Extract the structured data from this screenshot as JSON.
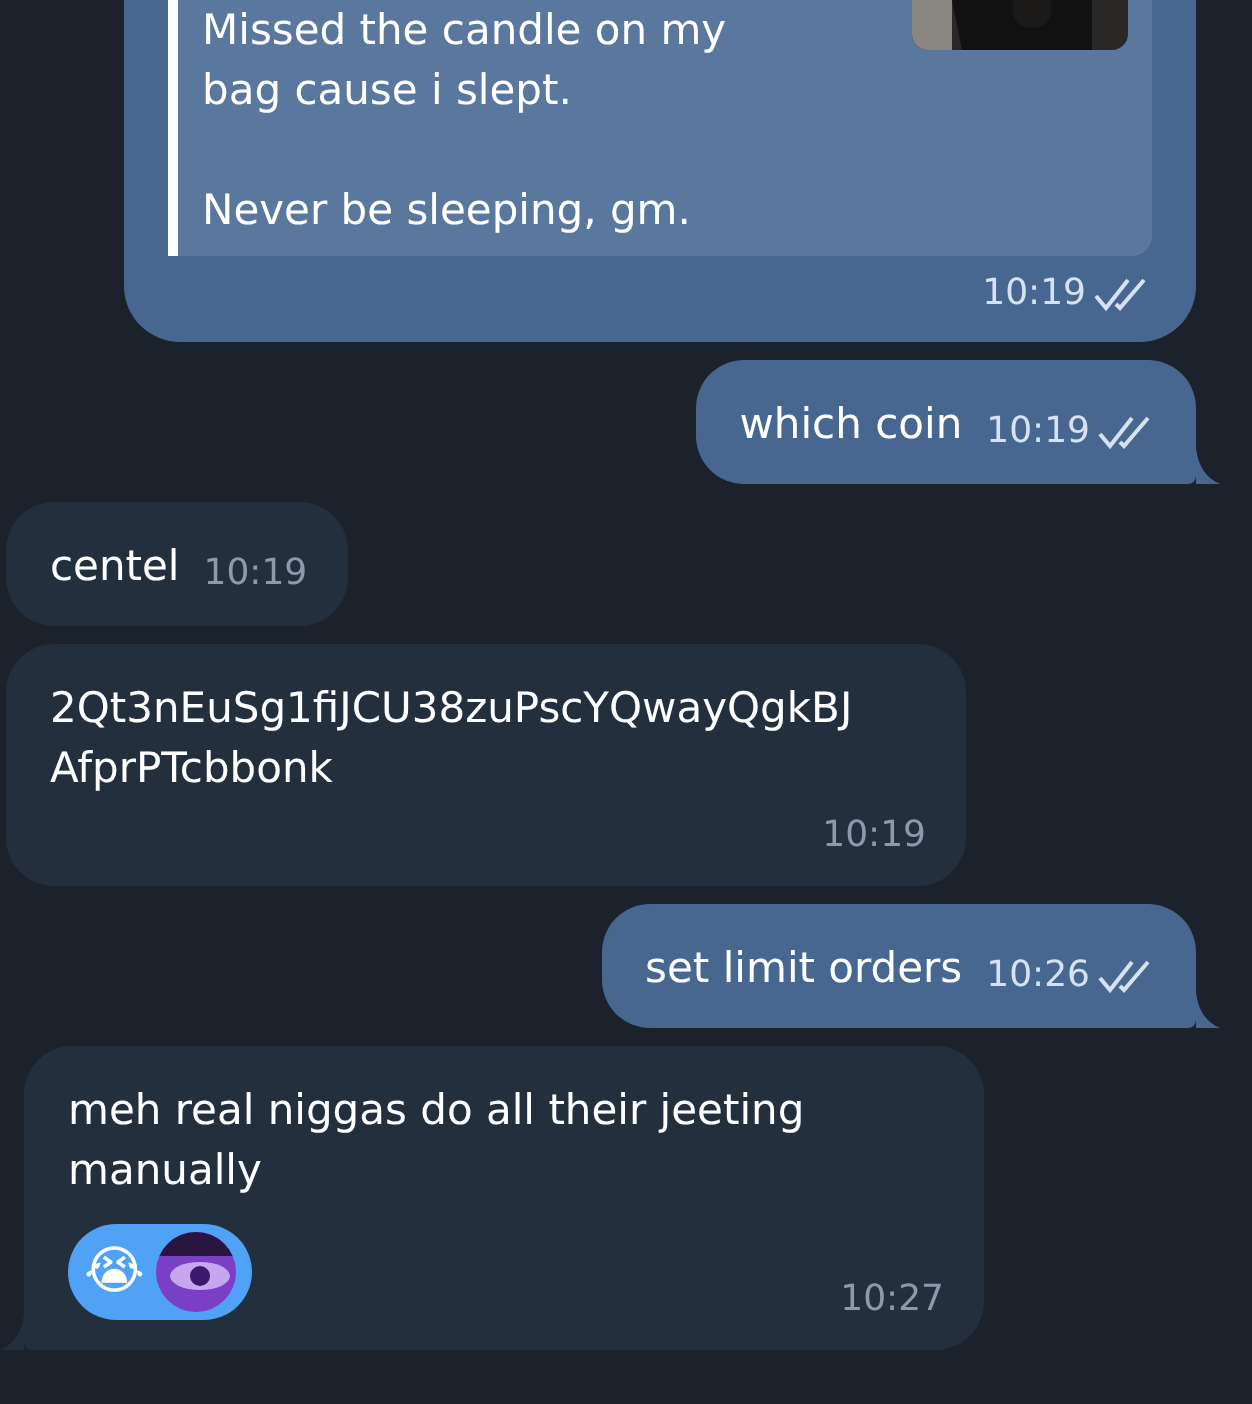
{
  "messages": [
    {
      "kind": "outgoing",
      "quote_paragraphs": [
        [
          "Missed the candle on my",
          "bag cause i slept."
        ],
        [
          "Never be sleeping, gm."
        ]
      ],
      "time": "10:19",
      "read": true,
      "tail": false
    },
    {
      "kind": "outgoing",
      "text": "which coin",
      "time": "10:19",
      "read": true,
      "tail": true
    },
    {
      "kind": "incoming",
      "text": "centel",
      "time": "10:19",
      "tail": false
    },
    {
      "kind": "incoming",
      "text": "2Qt3nEuSg1fiJCU38zuPscYQwayQgkBJ AfprPTcbbonk",
      "time": "10:19",
      "tail": false
    },
    {
      "kind": "outgoing",
      "text": "set limit orders",
      "time": "10:26",
      "read": true,
      "tail": true
    },
    {
      "kind": "incoming",
      "text": "meh real niggas do all their jeeting manually",
      "time": "10:27",
      "tail": true,
      "reactions": {
        "selected": true,
        "items": [
          {
            "kind": "emoji",
            "emoji": "😭"
          },
          {
            "kind": "picture"
          }
        ]
      }
    }
  ]
}
